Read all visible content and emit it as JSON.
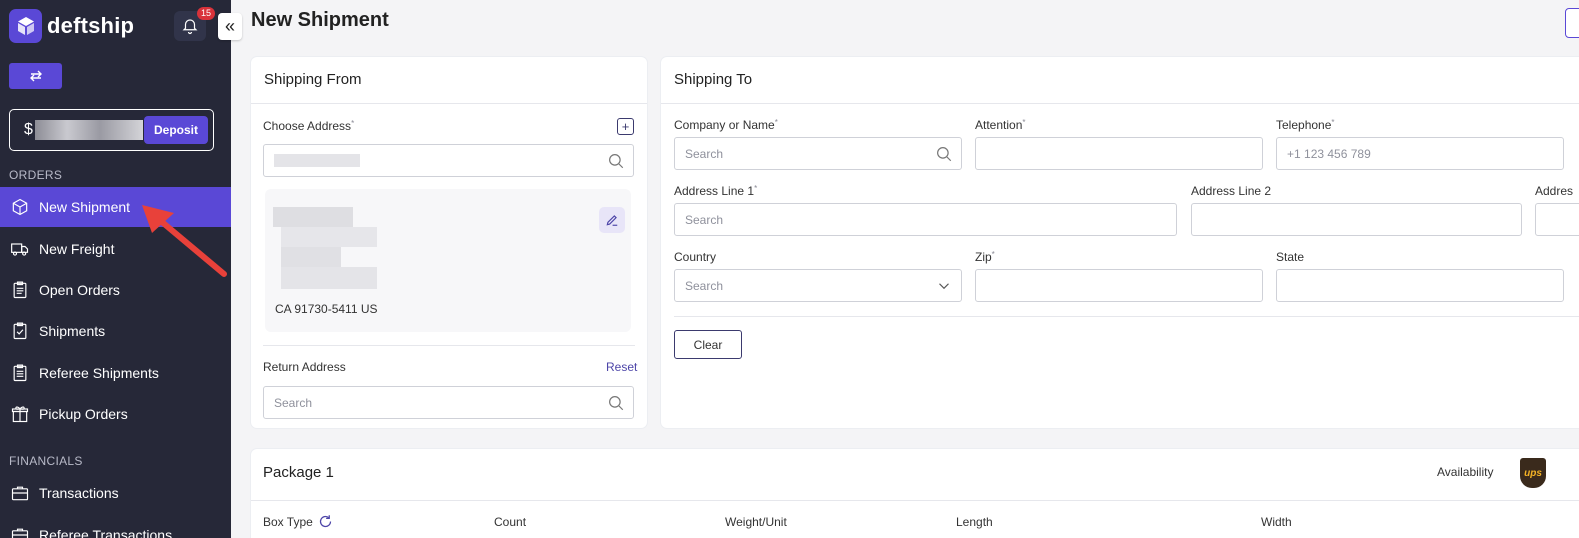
{
  "app": {
    "brand": "deftship",
    "notification_count": "15",
    "balance_prefix": "$",
    "deposit_label": "Deposit"
  },
  "sidebar": {
    "sections": [
      {
        "label": "ORDERS",
        "items": [
          {
            "label": "New Shipment",
            "icon": "box-icon",
            "active": true
          },
          {
            "label": "New Freight",
            "icon": "truck-icon"
          },
          {
            "label": "Open Orders",
            "icon": "clipboard-icon"
          },
          {
            "label": "Shipments",
            "icon": "clipboard-check-icon"
          },
          {
            "label": "Referee Shipments",
            "icon": "clipboard-list-icon"
          },
          {
            "label": "Pickup Orders",
            "icon": "gift-icon"
          }
        ]
      },
      {
        "label": "FINANCIALS",
        "items": [
          {
            "label": "Transactions",
            "icon": "briefcase-icon"
          },
          {
            "label": "Referee Transactions",
            "icon": "briefcase-icon"
          }
        ]
      }
    ]
  },
  "main": {
    "title": "New Shipment",
    "shipping_from": {
      "title": "Shipping From",
      "choose_address_label": "Choose Address",
      "address_line": "CA 91730-5411 US",
      "return_address_label": "Return Address",
      "reset_label": "Reset",
      "return_placeholder": "Search"
    },
    "shipping_to": {
      "title": "Shipping To",
      "company_label": "Company or Name",
      "company_placeholder": "Search",
      "attention_label": "Attention",
      "telephone_label": "Telephone",
      "telephone_placeholder": "+1 123 456 789",
      "address1_label": "Address Line 1",
      "address1_placeholder": "Search",
      "address2_label": "Address Line 2",
      "address3_label": "Addres",
      "country_label": "Country",
      "country_placeholder": "Search",
      "zip_label": "Zip",
      "state_label": "State",
      "clear_label": "Clear"
    },
    "package": {
      "title": "Package 1",
      "availability_label": "Availability",
      "carrier_logo": "ups",
      "columns": [
        "Box Type",
        "Count",
        "Weight/Unit",
        "Length",
        "Width"
      ]
    }
  },
  "colors": {
    "sidebar_bg": "#262838",
    "accent": "#5a48d6",
    "arrow": "#e8413a"
  }
}
